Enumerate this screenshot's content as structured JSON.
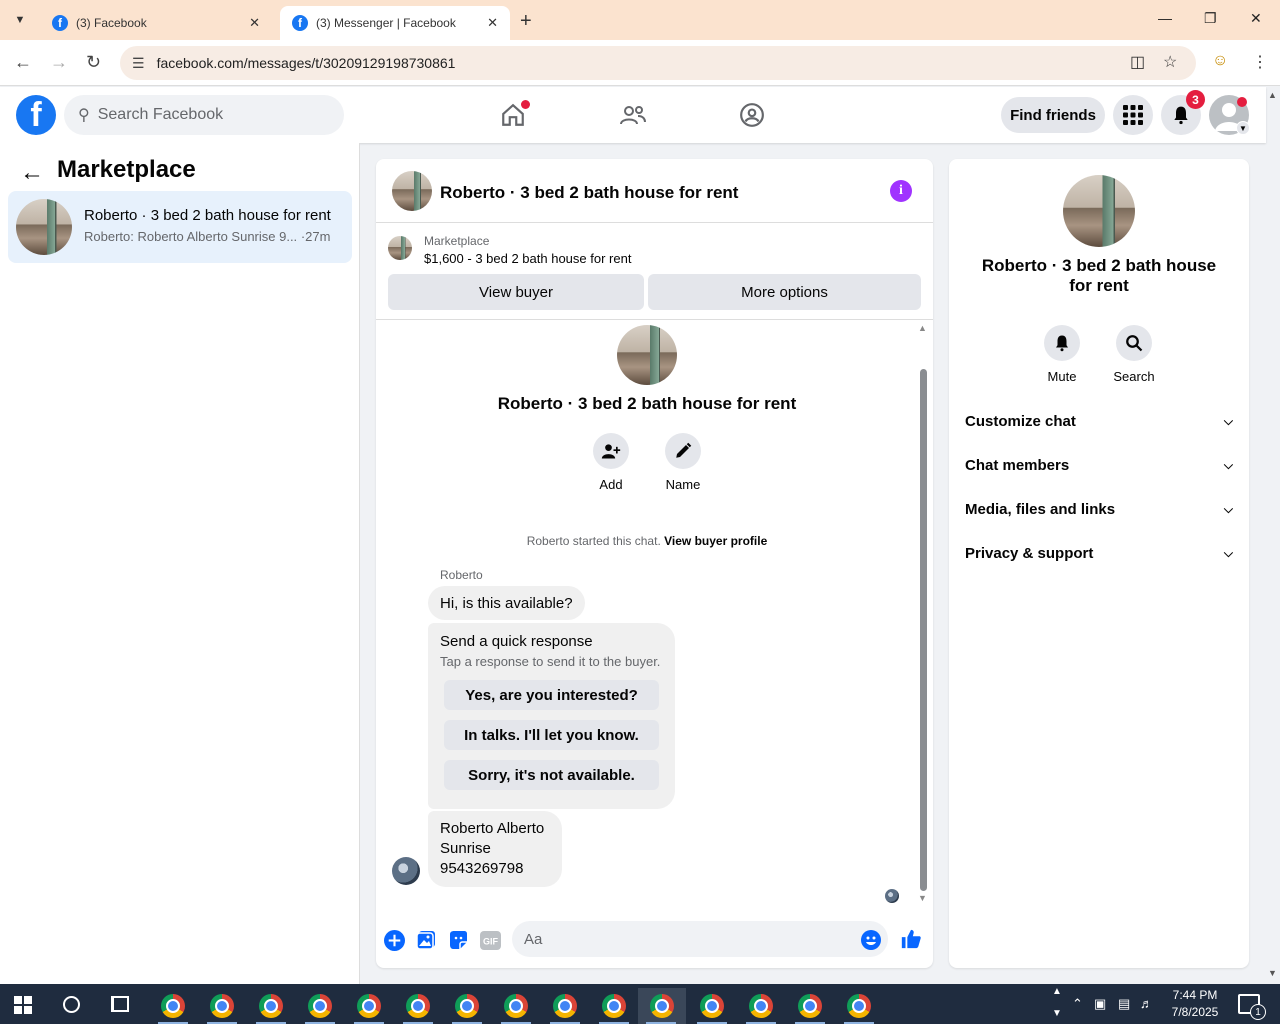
{
  "browser": {
    "tabs": [
      {
        "title": "(3) Facebook",
        "active": false
      },
      {
        "title": "(3) Messenger | Facebook",
        "active": true
      }
    ],
    "url": "facebook.com/messages/t/30209129198730861"
  },
  "facebook": {
    "search_placeholder": "Search Facebook",
    "find_friends_label": "Find friends",
    "notification_count": "3",
    "brand_color": "#1877f2"
  },
  "left_panel": {
    "title": "Marketplace",
    "conversation": {
      "name": "Roberto · 3 bed 2 bath house for rent",
      "preview": "Roberto: Roberto Alberto Sunrise 9...",
      "time": "·27m"
    }
  },
  "chat": {
    "title": "Roberto · 3 bed 2 bath house for rent",
    "marketplace_label": "Marketplace",
    "listing": "$1,600 - 3 bed 2 bath house for rent",
    "view_buyer_label": "View buyer",
    "more_options_label": "More options",
    "center_name": "Roberto · 3 bed 2 bath house for rent",
    "add_label": "Add",
    "name_label": "Name",
    "started_text": "Roberto started this chat.",
    "view_buyer_profile_label": "View buyer profile",
    "sender": "Roberto",
    "message1": "Hi, is this available?",
    "quick_response": {
      "title": "Send a quick response",
      "subtitle": "Tap a response to send it to the buyer.",
      "options": [
        "Yes, are you interested?",
        "In talks. I'll let you know.",
        "Sorry, it's not available."
      ]
    },
    "message2_lines": [
      "Roberto Alberto",
      "Sunrise",
      "9543269798"
    ],
    "composer_placeholder": "Aa"
  },
  "right_panel": {
    "name": "Roberto · 3 bed 2 bath house for rent",
    "mute_label": "Mute",
    "search_label": "Search",
    "sections": [
      "Customize chat",
      "Chat members",
      "Media, files and links",
      "Privacy & support"
    ]
  },
  "taskbar": {
    "time": "7:44 PM",
    "date": "7/8/2025",
    "notification_count": "1"
  },
  "icons": {
    "window_controls": [
      "minimize-icon",
      "restore-icon",
      "close-icon"
    ],
    "nav": [
      "home-icon",
      "friends-icon",
      "groups-icon"
    ]
  }
}
